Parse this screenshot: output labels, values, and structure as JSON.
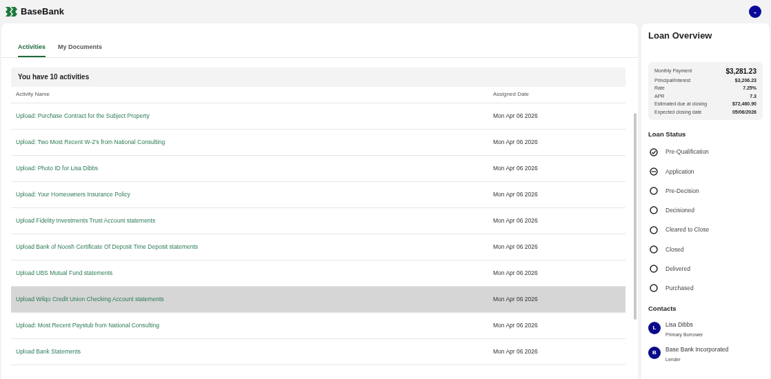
{
  "header": {
    "brand": "BaseBank",
    "user_initial": "-"
  },
  "tabs": [
    {
      "label": "Activities",
      "selected": true
    },
    {
      "label": "My Documents",
      "selected": false
    }
  ],
  "activities": {
    "summary": "You have 10 activities",
    "columns": [
      "Activity Name",
      "Assigned Date"
    ],
    "rows": [
      {
        "name": "Upload: Purchase Contract for the Subject Property",
        "date": "Mon Apr 06 2026",
        "selected": false
      },
      {
        "name": "Upload: Two Most Recent W-2's from National Consulting",
        "date": "Mon Apr 06 2026",
        "selected": false
      },
      {
        "name": "Upload: Photo ID for Lisa Dibbs",
        "date": "Mon Apr 06 2026",
        "selected": false
      },
      {
        "name": "Upload: Your Homeowners Insurance Policy",
        "date": "Mon Apr 06 2026",
        "selected": false
      },
      {
        "name": "Upload Fidelity Investments Trust Account statements",
        "date": "Mon Apr 06 2026",
        "selected": false
      },
      {
        "name": "Upload Bank of Noosh Certificate Of Deposit Time Deposit statements",
        "date": "Mon Apr 06 2026",
        "selected": false
      },
      {
        "name": "Upload UBS Mutual Fund statements",
        "date": "Mon Apr 06 2026",
        "selected": false
      },
      {
        "name": "Upload Wilqo Credit Union Checking Account statements",
        "date": "Mon Apr 06 2026",
        "selected": true
      },
      {
        "name": "Upload: Most Recent Paystub from National Consulting",
        "date": "Mon Apr 06 2026",
        "selected": false
      },
      {
        "name": "Upload Bank Statements",
        "date": "Mon Apr 06 2026",
        "selected": false
      }
    ]
  },
  "loan_overview": {
    "title": "Loan Overview",
    "summary": [
      {
        "label": "Monthly Payment",
        "value": "$3,281.23",
        "kind": "primary"
      },
      {
        "label": "Principal/Interest",
        "value": "$3,206.23",
        "kind": "detail"
      },
      {
        "label": "Rate",
        "value": "7.25%",
        "kind": "detail"
      },
      {
        "label": "APR",
        "value": "7.3",
        "kind": "detail"
      },
      {
        "label": "Estimated due at closing",
        "value": "$72,460.90",
        "kind": "detail"
      },
      {
        "label": "Expected closing date",
        "value": "05/06/2026",
        "kind": "detail"
      }
    ],
    "status_title": "Loan Status",
    "statuses": [
      {
        "label": "Pre-Qualification",
        "kind": "done"
      },
      {
        "label": "Application",
        "kind": "current"
      },
      {
        "label": "Pre-Decision",
        "kind": "pending"
      },
      {
        "label": "Decisioned",
        "kind": "pending"
      },
      {
        "label": "Cleared to Close",
        "kind": "pending"
      },
      {
        "label": "Closed",
        "kind": "pending"
      },
      {
        "label": "Delivered",
        "kind": "pending"
      },
      {
        "label": "Purchased",
        "kind": "pending"
      }
    ],
    "contacts_title": "Contacts",
    "contacts": [
      {
        "initial": "L",
        "name": "Lisa Dibbs",
        "role": "Primary Borrower"
      },
      {
        "initial": "B",
        "name": "Base Bank Incorporated",
        "role": "Lender"
      }
    ]
  }
}
